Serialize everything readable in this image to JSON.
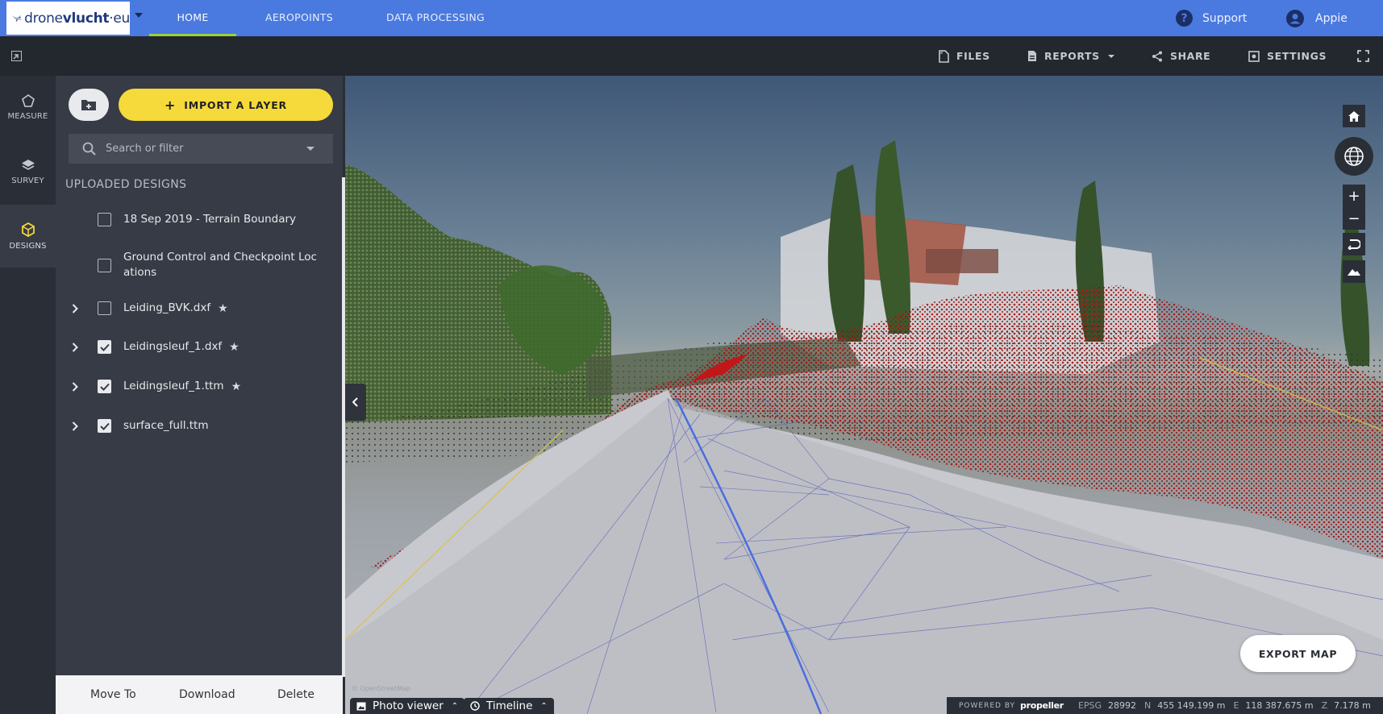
{
  "brand": {
    "name_pre": "drone",
    "name_main": "vlucht",
    "name_post": "·eu"
  },
  "nav": {
    "tabs": [
      {
        "label": "HOME",
        "active": true
      },
      {
        "label": "AEROPOINTS",
        "active": false
      },
      {
        "label": "DATA PROCESSING",
        "active": false
      }
    ],
    "support_label": "Support",
    "user_label": "Appie"
  },
  "toolbar": {
    "files_label": "FILES",
    "reports_label": "REPORTS",
    "share_label": "SHARE",
    "settings_label": "SETTINGS"
  },
  "rail": {
    "items": [
      {
        "label": "MEASURE",
        "icon": "polygon-icon",
        "active": false
      },
      {
        "label": "SURVEY",
        "icon": "layers-icon",
        "active": false
      },
      {
        "label": "DESIGNS",
        "icon": "cube-icon",
        "active": true
      }
    ]
  },
  "panel": {
    "import_label": "IMPORT A LAYER",
    "search_placeholder": "Search or filter",
    "section_title": "UPLOADED DESIGNS",
    "designs": [
      {
        "name": "18 Sep 2019 - Terrain Boundary",
        "checked": false,
        "expandable": false,
        "starred": false
      },
      {
        "name": "Ground Control and Checkpoint Loc ations",
        "checked": false,
        "expandable": false,
        "starred": false
      },
      {
        "name": "Leiding_BVK.dxf",
        "checked": false,
        "expandable": true,
        "starred": true
      },
      {
        "name": "Leidingsleuf_1.dxf",
        "checked": true,
        "expandable": true,
        "starred": true
      },
      {
        "name": "Leidingsleuf_1.ttm",
        "checked": true,
        "expandable": true,
        "starred": true
      },
      {
        "name": "surface_full.ttm",
        "checked": true,
        "expandable": true,
        "starred": false
      }
    ],
    "footer": {
      "move_to": "Move To",
      "download": "Download",
      "delete": "Delete"
    }
  },
  "map": {
    "export_label": "EXPORT MAP",
    "photo_viewer_label": "Photo viewer",
    "timeline_label": "Timeline",
    "status": {
      "powered_by": "POWERED BY",
      "provider": "propeller",
      "epsg_key": "EPSG",
      "epsg_value": "28992",
      "n_key": "N",
      "n_value": "455 149.199 m",
      "e_key": "E",
      "e_value": "118 387.675 m",
      "z_key": "Z",
      "z_value": "7.178 m"
    }
  },
  "colors": {
    "nav_blue": "#4a7ae0",
    "accent_yellow": "#f6d93a",
    "active_tab_underline": "#9ad13a",
    "design_red": "#b01515",
    "design_line_blue": "#4a6ee0"
  }
}
